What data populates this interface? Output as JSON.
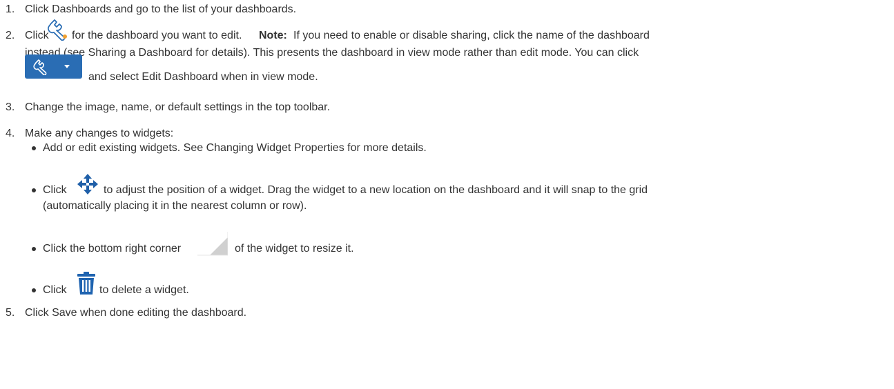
{
  "steps": [
    {
      "num": "1.",
      "text": "Click Dashboards and go to the list of your dashboards."
    },
    {
      "num": "2.",
      "text_a": "Click",
      "text_b": "for the dashboard you want to edit.",
      "note_label": "Note:",
      "text_c": "If you need to enable or disable sharing, click the name of the dashboard",
      "line2": "instead (see Sharing a Dashboard for details). This presents the dashboard in view mode rather than edit mode. You can click",
      "line3": "and select Edit Dashboard when in view mode."
    },
    {
      "num": "3.",
      "text": "Change the image, name, or default settings in the top toolbar."
    },
    {
      "num": "4.",
      "text": "Make any changes to widgets:"
    },
    {
      "num": "5.",
      "text": "Click Save when done editing the dashboard."
    }
  ],
  "sub_items": {
    "add_edit": "Add or edit existing widgets. See Changing Widget Properties for more details.",
    "move_a": "Click",
    "move_b": "to adjust the position of a widget. Drag the widget to a new location on the dashboard and it will snap to the grid",
    "move_c": "(automatically placing it in the nearest column or row).",
    "resize_a": "Click the bottom right corner",
    "resize_b": "of the widget to resize it.",
    "delete_a": "Click",
    "delete_b": "to delete a widget."
  },
  "icons": {
    "wrench": "wrench-icon",
    "wrench_dropdown": "wrench-dropdown-button",
    "move": "move-arrows-icon",
    "resize": "resize-corner-icon",
    "delete": "trash-icon"
  },
  "colors": {
    "text": "#333333",
    "wrench_stroke": "#2a6db4",
    "button_bg": "#2a6db4",
    "move_icon": "#1f5fa8",
    "trash_icon": "#1e63b0",
    "resize_corner": "#d0d0d0"
  }
}
